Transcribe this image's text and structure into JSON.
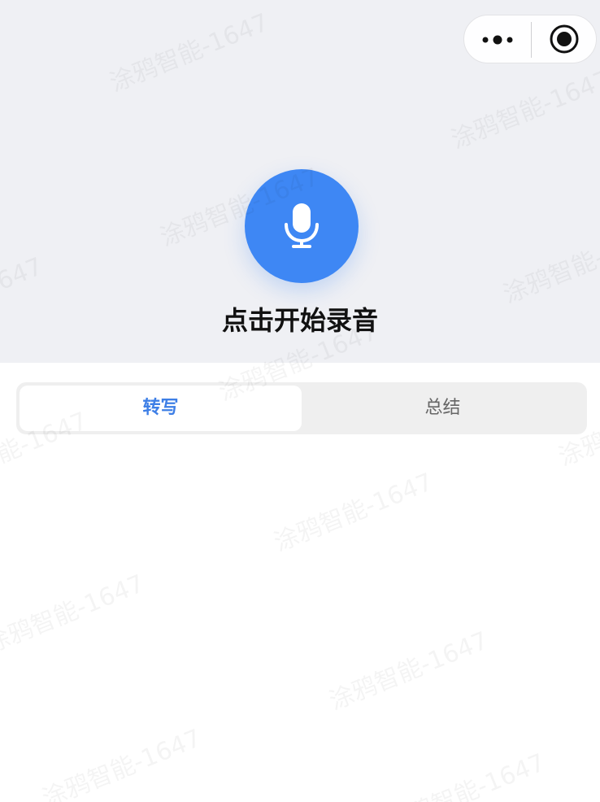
{
  "capsule": {
    "more_icon": "more-dots-icon",
    "close_icon": "record-circle-icon"
  },
  "recorder": {
    "mic_icon": "microphone-icon",
    "accent_color": "#3e87f4",
    "start_label": "点击开始录音"
  },
  "tabs": [
    {
      "label": "转写",
      "active": true
    },
    {
      "label": "总结",
      "active": false
    }
  ],
  "watermark": "涂鸦智能-1647"
}
